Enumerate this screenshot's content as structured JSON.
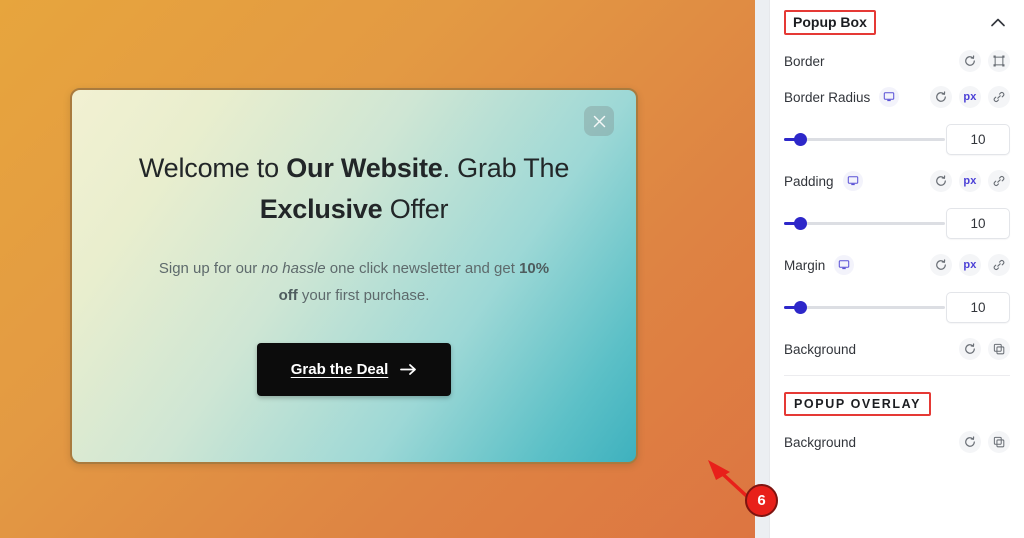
{
  "canvas": {
    "background_gradient_from": "#e7a53d",
    "background_gradient_to": "#dd7541",
    "popup": {
      "close_icon": "close-icon",
      "title_part1": "Welcome to ",
      "title_bold1": "Our Website",
      "title_part2": ". Grab The ",
      "title_bold2": "Exclusive",
      "title_part3": " Offer",
      "body_part1": "Sign up for our ",
      "body_italic": "no hassle",
      "body_part2": " one click newsletter and get ",
      "body_bold": "10% off",
      "body_part3": " your first purchase.",
      "cta_label": "Grab the Deal",
      "cta_icon": "arrow-right-icon",
      "background_from": "#f2f1d2",
      "background_to": "#3eb1be",
      "border_color": "#a97b3e",
      "cta_background": "#0c0c0c"
    }
  },
  "annotation": {
    "step_number": "6",
    "badge_color": "#e8201a",
    "arrow_icon": "arrow-pointer-icon"
  },
  "sidebar": {
    "panel": {
      "title": "Popup Box",
      "collapse_icon": "chevron-up-icon",
      "highlight_color": "#e53935"
    },
    "rows": [
      {
        "label": "Border",
        "has_device": false,
        "actions": [
          "reset-icon",
          "border-frame-icon"
        ]
      },
      {
        "label": "Border Radius",
        "has_device": true,
        "device_icon": "desktop-icon",
        "actions": [
          "reset-icon",
          "px",
          "link-icon"
        ]
      },
      {
        "label": "Padding",
        "has_device": true,
        "device_icon": "desktop-icon",
        "actions": [
          "reset-icon",
          "px",
          "link-icon"
        ]
      },
      {
        "label": "Margin",
        "has_device": true,
        "device_icon": "desktop-icon",
        "actions": [
          "reset-icon",
          "px",
          "link-icon"
        ]
      },
      {
        "label": "Background",
        "has_device": false,
        "actions": [
          "reset-icon",
          "copy-icon"
        ]
      }
    ],
    "sliders": [
      {
        "name": "border-radius",
        "value": "10",
        "percent": 10
      },
      {
        "name": "padding",
        "value": "10",
        "percent": 10
      },
      {
        "name": "margin",
        "value": "10",
        "percent": 10
      }
    ],
    "unit_label": "px",
    "overlay_section": {
      "title": "POPUP OVERLAY",
      "row_label": "Background",
      "actions": [
        "reset-icon",
        "copy-icon"
      ]
    },
    "accent_color": "#2d27c9",
    "unit_color": "#4a3fd6"
  }
}
